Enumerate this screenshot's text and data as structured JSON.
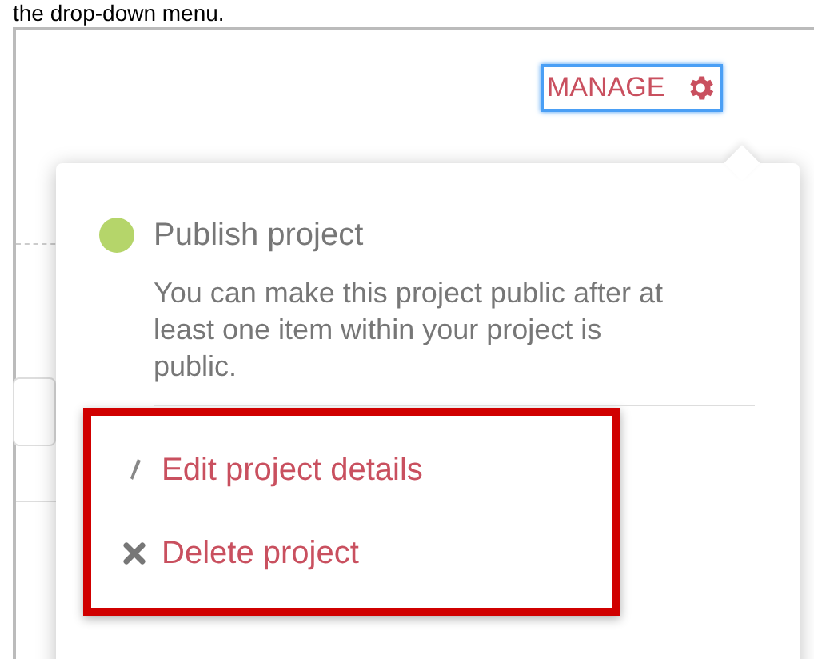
{
  "caption": "the drop-down menu.",
  "manage_button": {
    "label": "MANAGE",
    "focused": true
  },
  "menu": {
    "publish": {
      "title": "Publish project",
      "available": true,
      "description": "You can make this project public after at least one item within your project is public."
    },
    "actions": [
      {
        "kind": "edit",
        "label": "Edit project details"
      },
      {
        "kind": "delete",
        "label": "Delete project"
      }
    ],
    "highlighted": true
  }
}
